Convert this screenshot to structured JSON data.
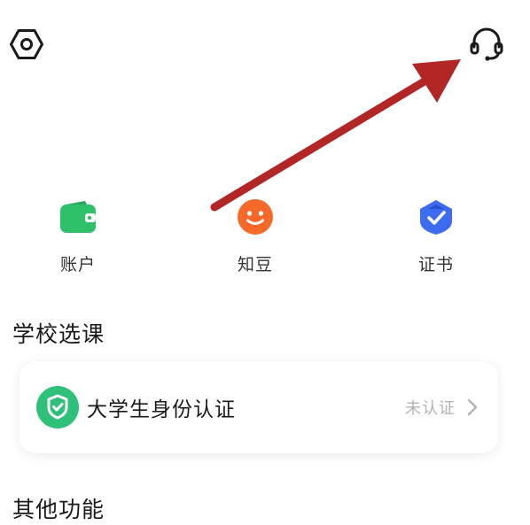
{
  "header": {
    "settings_icon": "settings-hexagon-icon",
    "service_icon": "headset-icon"
  },
  "quick_actions": [
    {
      "label": "账户",
      "icon": "wallet-icon",
      "color": "#2fc06a"
    },
    {
      "label": "知豆",
      "icon": "smiley-bean-icon",
      "color": "#f56a2b"
    },
    {
      "label": "证书",
      "icon": "certificate-badge-icon",
      "color": "#3d6cf0"
    }
  ],
  "sections": {
    "school_course_title": "学校选课",
    "other_functions_title": "其他功能"
  },
  "verification": {
    "label": "大学生身份认证",
    "status": "未认证",
    "icon": "shield-check-icon",
    "icon_color": "#2fc07a"
  },
  "annotation": {
    "arrow_color": "#b32626"
  }
}
